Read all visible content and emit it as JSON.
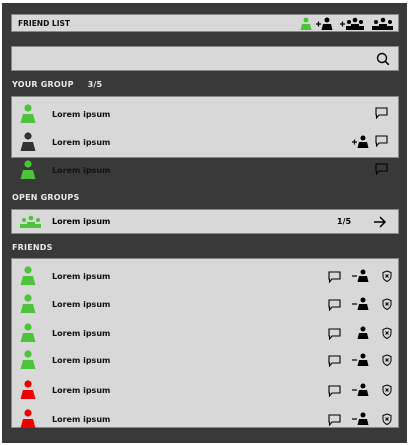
{
  "header": {
    "title": "FRIEND LIST",
    "icons": [
      "person-icon",
      "add-friend-icon",
      "add-group-icon",
      "group-icon"
    ],
    "active_color": "#4cc33a"
  },
  "search": {
    "placeholder": "",
    "value": ""
  },
  "your_group": {
    "label": "YOUR GROUP",
    "count": "3/5",
    "members": [
      {
        "name": "Lorem ipsum",
        "status": "online",
        "color": "#4cc33a",
        "actions": [
          "chat"
        ]
      },
      {
        "name": "Lorem ipsum",
        "status": "offline",
        "color": "#333333",
        "actions": [
          "add-friend",
          "chat"
        ]
      },
      {
        "name": "Lorem ipsum",
        "status": "online",
        "color": "#4cc33a",
        "actions": [
          "chat"
        ]
      }
    ]
  },
  "open_groups": {
    "label": "OPEN GROUPS",
    "items": [
      {
        "name": "Lorem ipsum",
        "count": "1/5",
        "color": "#4cc33a"
      }
    ]
  },
  "friends": {
    "label": "FRIENDS",
    "items": [
      {
        "name": "Lorem ipsum",
        "color": "#4cc33a",
        "remove": true
      },
      {
        "name": "Lorem ipsum",
        "color": "#4cc33a",
        "remove": true
      },
      {
        "name": "Lorem ipsum",
        "color": "#4cc33a",
        "remove": false
      },
      {
        "name": "Lorem ipsum",
        "color": "#4cc33a",
        "remove": true
      },
      {
        "name": "Lorem ipsum",
        "color": "#ee0000",
        "remove": true
      },
      {
        "name": "Lorem ipsum",
        "color": "#ee0000",
        "remove": true
      }
    ]
  }
}
